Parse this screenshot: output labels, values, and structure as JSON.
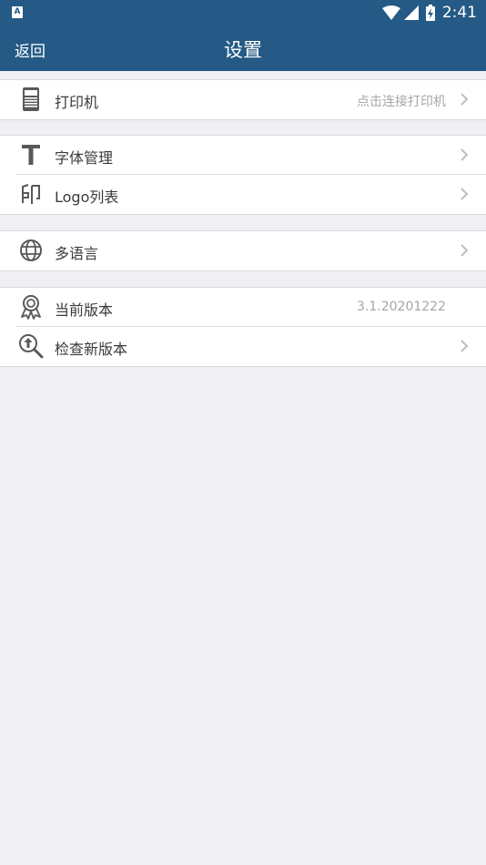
{
  "status_bar": {
    "left_icon_letter": "A",
    "time": "2:41",
    "icons": [
      "wifi-icon",
      "cell-signal-icon",
      "battery-charging-icon"
    ]
  },
  "header": {
    "back_label": "返回",
    "title": "设置"
  },
  "groups": [
    {
      "items": [
        {
          "icon": "printer-icon",
          "label": "打印机",
          "value": "点击连接打印机",
          "arrow": true
        }
      ]
    },
    {
      "items": [
        {
          "icon": "font-icon",
          "label": "字体管理",
          "value": "",
          "arrow": true
        },
        {
          "icon": "stamp-icon",
          "label": "Logo列表",
          "value": "",
          "arrow": true
        }
      ]
    },
    {
      "items": [
        {
          "icon": "globe-icon",
          "label": "多语言",
          "value": "",
          "arrow": true
        }
      ]
    },
    {
      "items": [
        {
          "icon": "badge-icon",
          "label": "当前版本",
          "value": "3.1.20201222",
          "arrow": false
        },
        {
          "icon": "search-upgrade-icon",
          "label": "检查新版本",
          "value": "",
          "arrow": true
        }
      ]
    }
  ],
  "colors": {
    "header_bg": "#245a85",
    "page_bg": "#efeff4",
    "icon": "#595959",
    "value_text": "#a6a6a6"
  }
}
